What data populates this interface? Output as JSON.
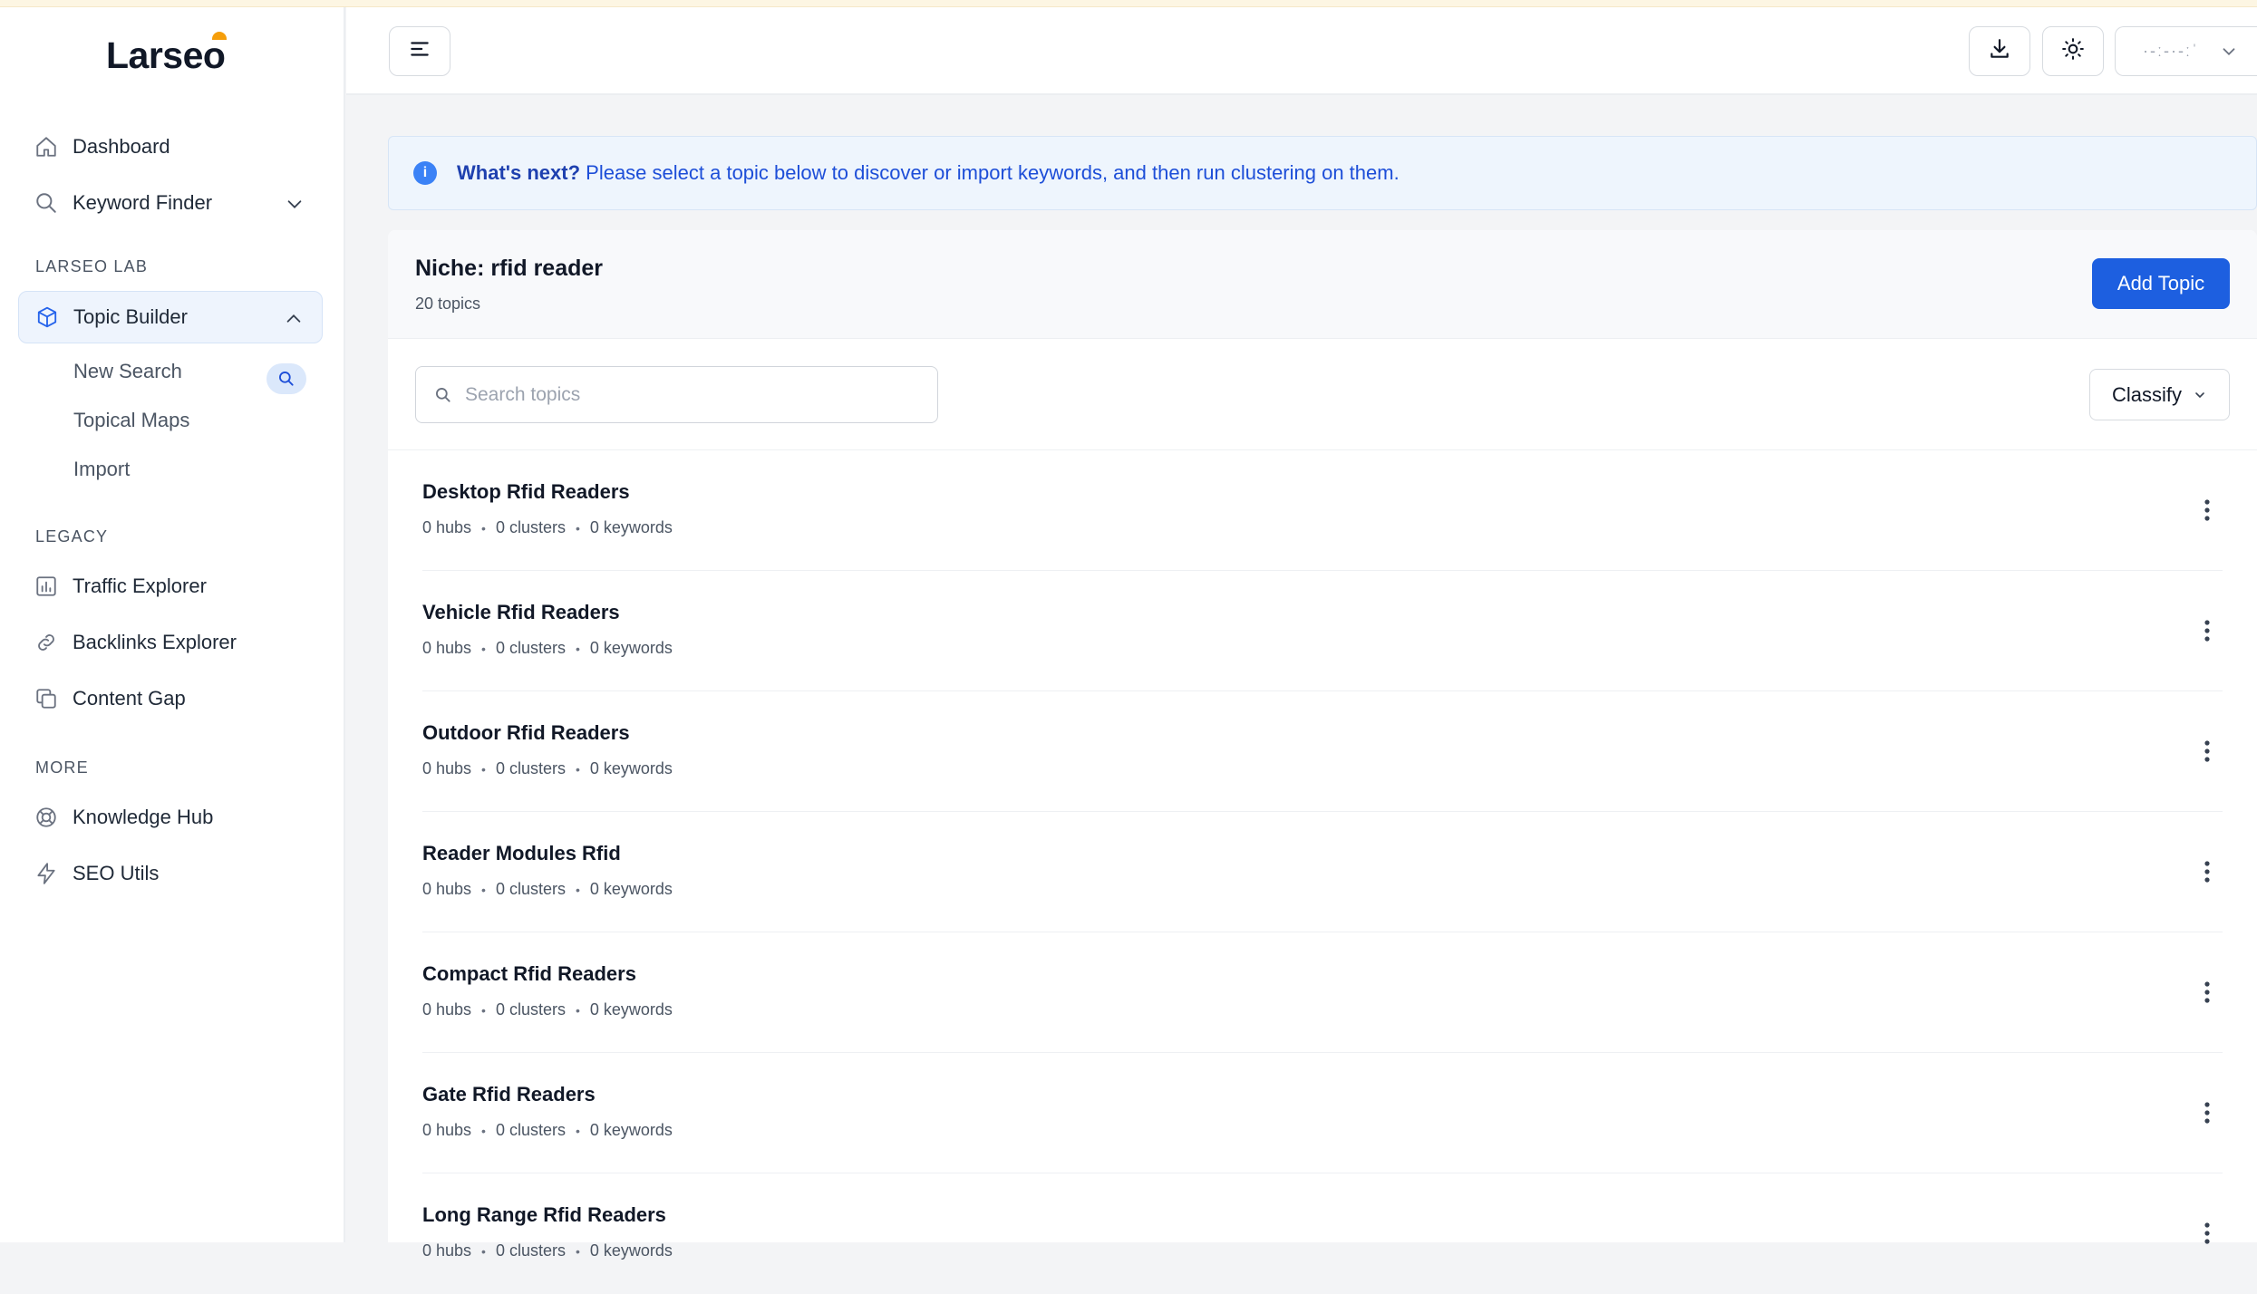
{
  "brand": {
    "name": "Larseo",
    "accent": "#f59e0b"
  },
  "sidebar": {
    "dashboard": "Dashboard",
    "keyword_finder": "Keyword Finder",
    "section_lab": "LARSEO LAB",
    "topic_builder": "Topic Builder",
    "sub_items": [
      "New Search",
      "Topical Maps",
      "Import"
    ],
    "section_legacy": "LEGACY",
    "traffic_explorer": "Traffic Explorer",
    "backlinks_explorer": "Backlinks Explorer",
    "content_gap": "Content Gap",
    "section_more": "MORE",
    "knowledge_hub": "Knowledge Hub",
    "seo_utils": "SEO Utils"
  },
  "header": {
    "user_label": "·-ː-·-ːˈ",
    "icons": [
      "menu-icon",
      "download-icon",
      "sun-icon",
      "chevron-down-icon"
    ]
  },
  "banner": {
    "bold": "What's next?",
    "text": " Please select a topic below to discover or import keywords, and then run clustering on them."
  },
  "niche": {
    "title": "Niche: rfid reader",
    "count": "20 topics",
    "add_button": "Add Topic"
  },
  "search": {
    "placeholder": "Search topics"
  },
  "classify": {
    "label": "Classify"
  },
  "topics": [
    {
      "title": "Desktop Rfid Readers",
      "hubs": "0 hubs",
      "clusters": "0 clusters",
      "keywords": "0 keywords"
    },
    {
      "title": "Vehicle Rfid Readers",
      "hubs": "0 hubs",
      "clusters": "0 clusters",
      "keywords": "0 keywords"
    },
    {
      "title": "Outdoor Rfid Readers",
      "hubs": "0 hubs",
      "clusters": "0 clusters",
      "keywords": "0 keywords"
    },
    {
      "title": "Reader Modules Rfid",
      "hubs": "0 hubs",
      "clusters": "0 clusters",
      "keywords": "0 keywords"
    },
    {
      "title": "Compact Rfid Readers",
      "hubs": "0 hubs",
      "clusters": "0 clusters",
      "keywords": "0 keywords"
    },
    {
      "title": "Gate Rfid Readers",
      "hubs": "0 hubs",
      "clusters": "0 clusters",
      "keywords": "0 keywords"
    },
    {
      "title": "Long Range Rfid Readers",
      "hubs": "0 hubs",
      "clusters": "0 clusters",
      "keywords": "0 keywords"
    }
  ]
}
